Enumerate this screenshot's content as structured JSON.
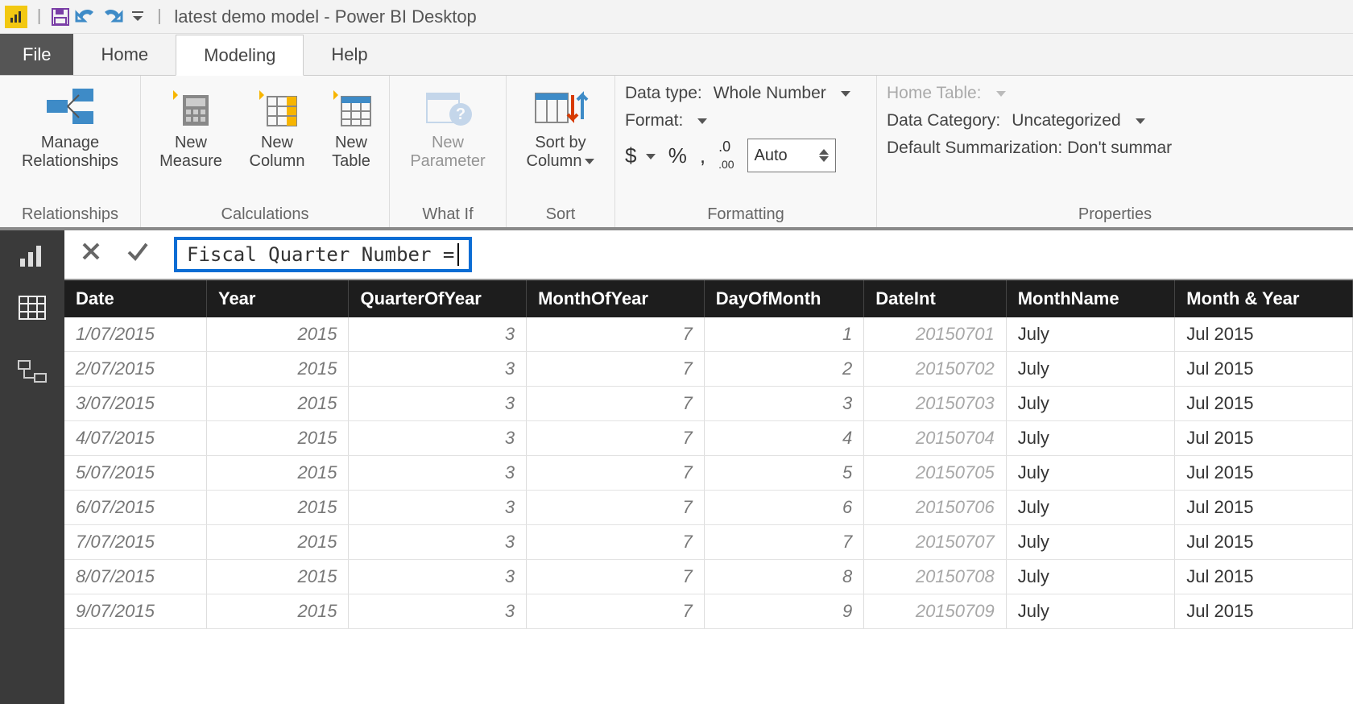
{
  "titlebar": {
    "app_title": "latest demo model - Power BI Desktop"
  },
  "tabs": {
    "file": "File",
    "home": "Home",
    "modeling": "Modeling",
    "help": "Help"
  },
  "ribbon": {
    "relationships": {
      "manage": "Manage\nRelationships",
      "group": "Relationships"
    },
    "calculations": {
      "new_measure": "New\nMeasure",
      "new_column": "New\nColumn",
      "new_table": "New\nTable",
      "group": "Calculations"
    },
    "whatif": {
      "new_parameter": "New\nParameter",
      "group": "What If"
    },
    "sort": {
      "sort_by": "Sort by\nColumn",
      "group": "Sort"
    },
    "formatting": {
      "data_type_label": "Data type:",
      "data_type_value": "Whole Number",
      "format_label": "Format:",
      "currency": "$",
      "percent": "%",
      "thousand": ",",
      "decimals_icon": ".0",
      "auto": "Auto",
      "group": "Formatting"
    },
    "properties": {
      "home_table": "Home Table:",
      "data_category_label": "Data Category:",
      "data_category_value": "Uncategorized",
      "summarization": "Default Summarization: Don't summar",
      "group": "Properties"
    }
  },
  "formula": {
    "expr": "Fiscal Quarter Number = "
  },
  "table": {
    "headers": [
      "Date",
      "Year",
      "QuarterOfYear",
      "MonthOfYear",
      "DayOfMonth",
      "DateInt",
      "MonthName",
      "Month & Year"
    ],
    "rows": [
      [
        "1/07/2015",
        "2015",
        "3",
        "7",
        "1",
        "20150701",
        "July",
        "Jul 2015"
      ],
      [
        "2/07/2015",
        "2015",
        "3",
        "7",
        "2",
        "20150702",
        "July",
        "Jul 2015"
      ],
      [
        "3/07/2015",
        "2015",
        "3",
        "7",
        "3",
        "20150703",
        "July",
        "Jul 2015"
      ],
      [
        "4/07/2015",
        "2015",
        "3",
        "7",
        "4",
        "20150704",
        "July",
        "Jul 2015"
      ],
      [
        "5/07/2015",
        "2015",
        "3",
        "7",
        "5",
        "20150705",
        "July",
        "Jul 2015"
      ],
      [
        "6/07/2015",
        "2015",
        "3",
        "7",
        "6",
        "20150706",
        "July",
        "Jul 2015"
      ],
      [
        "7/07/2015",
        "2015",
        "3",
        "7",
        "7",
        "20150707",
        "July",
        "Jul 2015"
      ],
      [
        "8/07/2015",
        "2015",
        "3",
        "7",
        "8",
        "20150708",
        "July",
        "Jul 2015"
      ],
      [
        "9/07/2015",
        "2015",
        "3",
        "7",
        "9",
        "20150709",
        "July",
        "Jul 2015"
      ]
    ]
  }
}
